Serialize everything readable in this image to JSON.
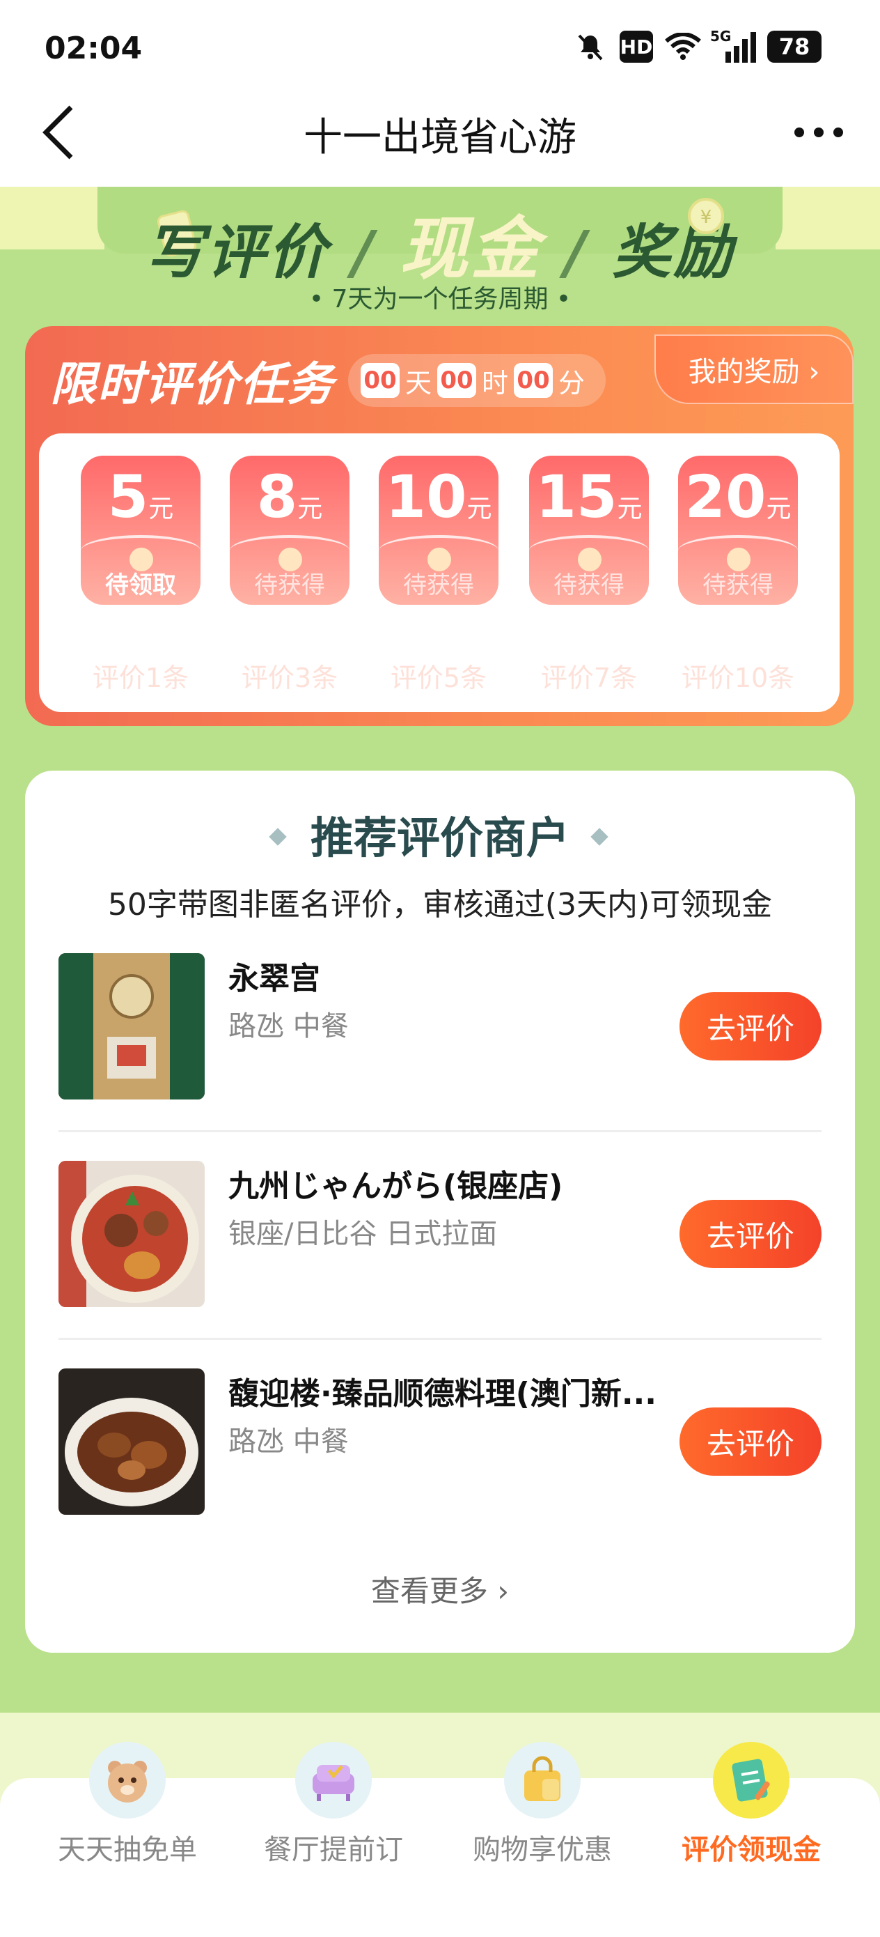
{
  "status_bar": {
    "time": "02:04",
    "hd": "HD",
    "network": "5G",
    "battery": "78"
  },
  "nav": {
    "title": "十一出境省心游"
  },
  "banner": {
    "headline_prefix": "写评价",
    "headline_highlight": "现金",
    "headline_suffix": "奖励",
    "subline": "• 7天为一个任务周期 •"
  },
  "task": {
    "title": "限时评价任务",
    "countdown": {
      "days": "00",
      "days_unit": "天",
      "hours": "00",
      "hours_unit": "时",
      "minutes": "00",
      "minutes_unit": "分"
    },
    "my_reward": "我的奖励 ›",
    "rewards": [
      {
        "amount": "5",
        "unit": "元",
        "status": "待领取",
        "caption": "评价1条"
      },
      {
        "amount": "8",
        "unit": "元",
        "status": "待获得",
        "caption": "评价3条"
      },
      {
        "amount": "10",
        "unit": "元",
        "status": "待获得",
        "caption": "评价5条"
      },
      {
        "amount": "15",
        "unit": "元",
        "status": "待获得",
        "caption": "评价7条"
      },
      {
        "amount": "20",
        "unit": "元",
        "status": "待获得",
        "caption": "评价10条"
      }
    ]
  },
  "recommend": {
    "title": "推荐评价商户",
    "subtitle": "50字带图非匿名评价，审核通过(3天内)可领现金",
    "merchants": [
      {
        "name": "永翠宫",
        "meta": "路氹 中餐",
        "button": "去评价"
      },
      {
        "name": "九州じゃんがら(银座店)",
        "meta": "银座/日比谷 日式拉面",
        "button": "去评价"
      },
      {
        "name": "馥迎楼·臻品顺德料理(澳门新...",
        "meta": "路氹 中餐",
        "button": "去评价"
      }
    ],
    "more": "查看更多 ›"
  },
  "tabs": [
    {
      "label": "天天抽免单",
      "icon": "bear-icon"
    },
    {
      "label": "餐厅提前订",
      "icon": "sofa-icon"
    },
    {
      "label": "购物享优惠",
      "icon": "shopping-bag-icon"
    },
    {
      "label": "评价领现金",
      "icon": "notepad-icon",
      "active": true
    }
  ],
  "colors": {
    "accent": "#ff6a21",
    "banner_green": "#b9e08a",
    "task_red": "#f26a52"
  }
}
